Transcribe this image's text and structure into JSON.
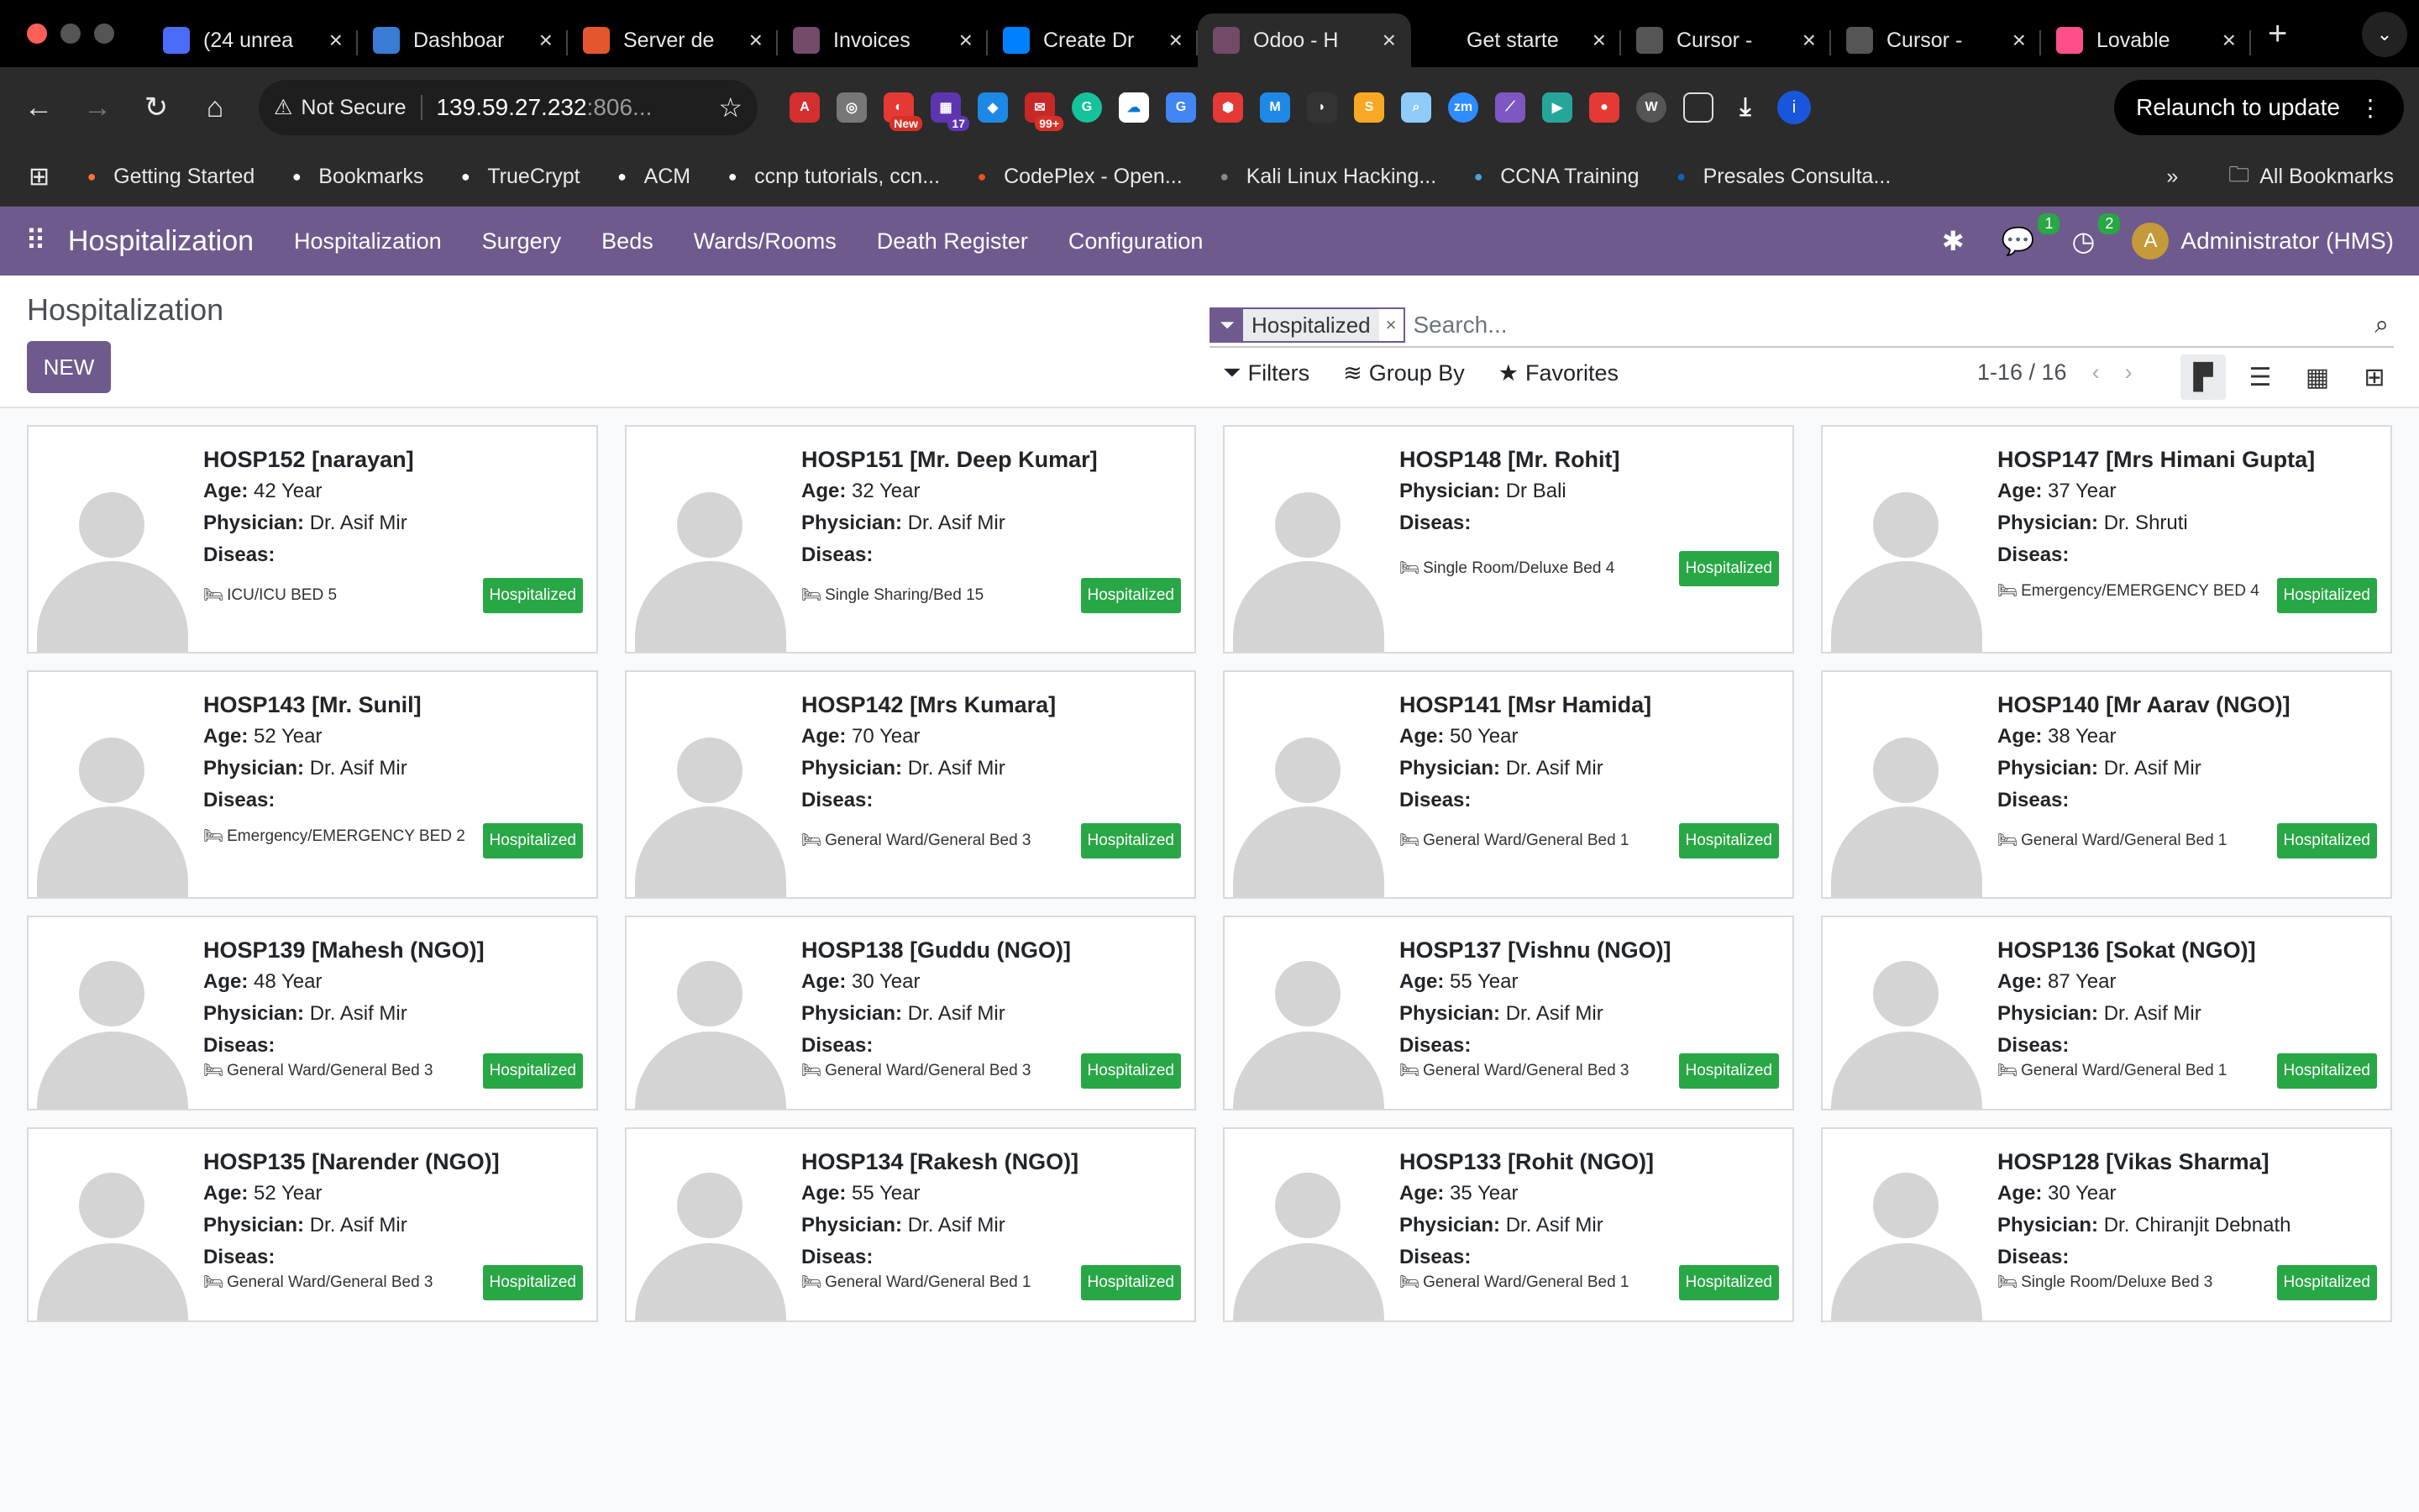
{
  "browser": {
    "tabs": [
      {
        "title": "(24 unrea",
        "color": "#4a6cf7",
        "icon": "inbox"
      },
      {
        "title": "Dashboar",
        "color": "#3a7bd5",
        "icon": "B"
      },
      {
        "title": "Server de",
        "color": "#e4572e",
        "icon": "grid"
      },
      {
        "title": "Invoices",
        "color": "#714b67",
        "icon": "odoo"
      },
      {
        "title": "Create Dr",
        "color": "#0080ff",
        "icon": "D"
      },
      {
        "title": "Odoo - H",
        "color": "#714b67",
        "icon": "odoo"
      },
      {
        "title": "Get starte",
        "color": "#000000",
        "icon": "cursor"
      },
      {
        "title": "Cursor - ",
        "color": "#555555",
        "icon": "cursor"
      },
      {
        "title": "Cursor - ",
        "color": "#555555",
        "icon": "cursor"
      },
      {
        "title": "Lovable",
        "color": "#ff4f8b",
        "icon": "heart"
      }
    ],
    "active_tab_index": 5,
    "not_secure_label": "Not Secure",
    "url_host": "139.59.27.232",
    "url_rest": ":806...",
    "relaunch_label": "Relaunch to update",
    "extension_badges": {
      "new": "New",
      "seventeen": "17",
      "ninety_nine": "99+"
    },
    "bookmarks": [
      {
        "label": "Getting Started",
        "color": "#ff7139"
      },
      {
        "label": "Bookmarks",
        "color": "#ffffff"
      },
      {
        "label": "TrueCrypt",
        "color": "#ffffff"
      },
      {
        "label": "ACM",
        "color": "#ffffff"
      },
      {
        "label": "ccnp tutorials, ccn...",
        "color": "#ffffff"
      },
      {
        "label": "CodePlex - Open...",
        "color": "#f25022"
      },
      {
        "label": "Kali Linux Hacking...",
        "color": "#888888"
      },
      {
        "label": "CCNA Training",
        "color": "#4aa3df"
      },
      {
        "label": "Presales Consulta...",
        "color": "#0a66c2"
      }
    ],
    "all_bookmarks_label": "All Bookmarks"
  },
  "odoo": {
    "brand": "Hospitalization",
    "menu": [
      "Hospitalization",
      "Surgery",
      "Beds",
      "Wards/Rooms",
      "Death Register",
      "Configuration"
    ],
    "chat_count": "1",
    "activity_count": "2",
    "user_initial": "A",
    "user_name": "Administrator (HMS)",
    "accent_color": "#6f5a8e"
  },
  "control": {
    "breadcrumb": "Hospitalization",
    "new_label": "NEW",
    "facet_label": "Hospitalized",
    "search_placeholder": "Search...",
    "filters_label": "Filters",
    "groupby_label": "Group By",
    "favorites_label": "Favorites",
    "pager": "1-16 / 16"
  },
  "labels": {
    "age": "Age:",
    "physician": "Physician:",
    "diseas": "Diseas:",
    "status": "Hospitalized"
  },
  "cards": [
    {
      "title": "HOSP152 [narayan]",
      "age": "42 Year",
      "physician": "Dr. Asif Mir",
      "bed": "ICU/ICU BED 5"
    },
    {
      "title": "HOSP151 [Mr. Deep Kumar]",
      "age": "32 Year",
      "physician": "Dr. Asif Mir",
      "bed": "Single Sharing/Bed 15"
    },
    {
      "title": "HOSP148 [Mr. Rohit]",
      "age": "",
      "physician": "Dr Bali",
      "bed": "Single Room/Deluxe Bed 4"
    },
    {
      "title": "HOSP147 [Mrs Himani Gupta]",
      "age": "37 Year",
      "physician": "Dr. Shruti",
      "bed": "Emergency/EMERGENCY BED 4"
    },
    {
      "title": "HOSP143 [Mr. Sunil]",
      "age": "52 Year",
      "physician": "Dr. Asif Mir",
      "bed": "Emergency/EMERGENCY BED 2"
    },
    {
      "title": "HOSP142 [Mrs Kumara]",
      "age": "70 Year",
      "physician": "Dr. Asif Mir",
      "bed": "General Ward/General Bed 3"
    },
    {
      "title": "HOSP141 [Msr Hamida]",
      "age": "50 Year",
      "physician": "Dr. Asif Mir",
      "bed": "General Ward/General Bed 1"
    },
    {
      "title": "HOSP140 [Mr Aarav (NGO)]",
      "age": "38 Year",
      "physician": "Dr. Asif Mir",
      "bed": "General Ward/General Bed 1"
    },
    {
      "title": "HOSP139 [Mahesh (NGO)]",
      "age": "48 Year",
      "physician": "Dr. Asif Mir",
      "bed": "General Ward/General Bed 3"
    },
    {
      "title": "HOSP138 [Guddu (NGO)]",
      "age": "30 Year",
      "physician": "Dr. Asif Mir",
      "bed": "General Ward/General Bed 3"
    },
    {
      "title": "HOSP137 [Vishnu (NGO)]",
      "age": "55 Year",
      "physician": "Dr. Asif Mir",
      "bed": "General Ward/General Bed 3"
    },
    {
      "title": "HOSP136 [Sokat (NGO)]",
      "age": "87 Year",
      "physician": "Dr. Asif Mir",
      "bed": "General Ward/General Bed 1"
    },
    {
      "title": "HOSP135 [Narender (NGO)]",
      "age": "52 Year",
      "physician": "Dr. Asif Mir",
      "bed": "General Ward/General Bed 3"
    },
    {
      "title": "HOSP134 [Rakesh (NGO)]",
      "age": "55 Year",
      "physician": "Dr. Asif Mir",
      "bed": "General Ward/General Bed 1"
    },
    {
      "title": "HOSP133 [Rohit (NGO)]",
      "age": "35 Year",
      "physician": "Dr. Asif Mir",
      "bed": "General Ward/General Bed 1"
    },
    {
      "title": "HOSP128 [Vikas Sharma]",
      "age": "30 Year",
      "physician": "Dr. Chiranjit Debnath",
      "bed": "Single Room/Deluxe Bed 3"
    }
  ]
}
